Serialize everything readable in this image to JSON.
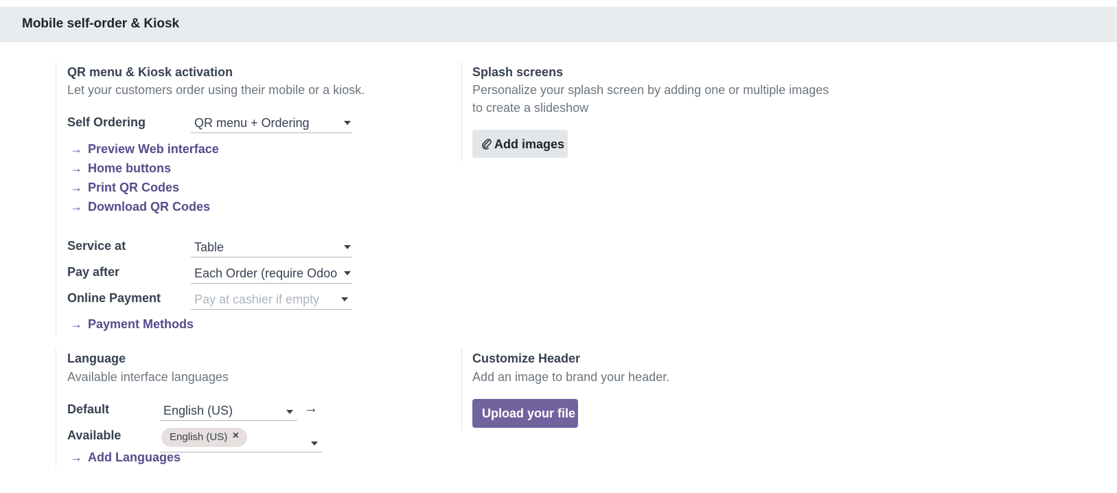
{
  "section": {
    "title": "Mobile self-order & Kiosk"
  },
  "qr_block": {
    "title": "QR menu & Kiosk activation",
    "description": "Let your customers order using their mobile or a kiosk.",
    "self_ordering_label": "Self Ordering",
    "self_ordering_value": "QR menu + Ordering",
    "links": [
      "Preview Web interface",
      "Home buttons",
      "Print QR Codes",
      "Download QR Codes"
    ],
    "service_at_label": "Service at",
    "service_at_value": "Table",
    "pay_after_label": "Pay after",
    "pay_after_value": "Each Order (require Odoo Payment)",
    "online_payment_label": "Online Payment",
    "online_payment_placeholder": "Pay at cashier if empty",
    "payment_methods_link": "Payment Methods"
  },
  "splash_block": {
    "title": "Splash screens",
    "description_line1": "Personalize your splash screen by adding one or multiple images",
    "description_line2": "to create a slideshow",
    "add_images_label": "Add images"
  },
  "language_block": {
    "title": "Language",
    "description": "Available interface languages",
    "default_label": "Default",
    "default_value": "English (US)",
    "available_label": "Available",
    "available_tags": [
      "English (US)"
    ],
    "add_languages_link": "Add Languages"
  },
  "header_block": {
    "title": "Customize Header",
    "description": "Add an image to brand your header.",
    "upload_label": "Upload your file"
  },
  "icons": {
    "arrow": "→",
    "paperclip": "paperclip-icon",
    "remove": "×"
  },
  "colors": {
    "link": "#574b8c",
    "primary_button": "#71639e",
    "header_bg": "#e9ecef"
  }
}
